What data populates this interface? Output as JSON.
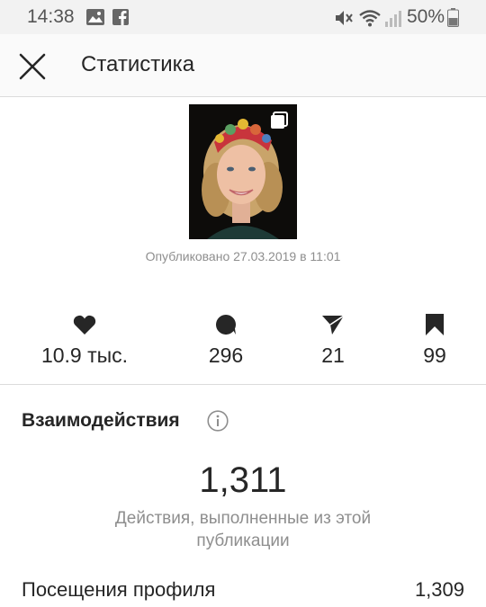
{
  "status_bar": {
    "time": "14:38",
    "battery": "50%",
    "icons": [
      "image-icon",
      "facebook-icon",
      "mute-icon",
      "wifi-icon",
      "signal-icon",
      "battery-icon"
    ]
  },
  "header": {
    "title": "Статистика",
    "close_icon": "close-icon"
  },
  "post": {
    "published": "Опубликовано 27.03.2019 в 11:01",
    "type_icon": "carousel-icon"
  },
  "metrics": [
    {
      "icon": "heart-icon",
      "value": "10.9 тыс."
    },
    {
      "icon": "comment-icon",
      "value": "296"
    },
    {
      "icon": "share-icon",
      "value": "21"
    },
    {
      "icon": "bookmark-icon",
      "value": "99"
    }
  ],
  "interactions": {
    "title": "Взаимодействия",
    "info_icon": "info-icon",
    "total": "1,311",
    "caption": "Действия, выполненные из этой публикации",
    "rows": [
      {
        "label": "Посещения профиля",
        "value": "1,309"
      }
    ]
  },
  "colors": {
    "text": "#262626",
    "secondary": "#8e8e8e",
    "divider": "#dbdbdb",
    "status_bg": "#f2f2f2",
    "header_bg": "#fafafa"
  }
}
